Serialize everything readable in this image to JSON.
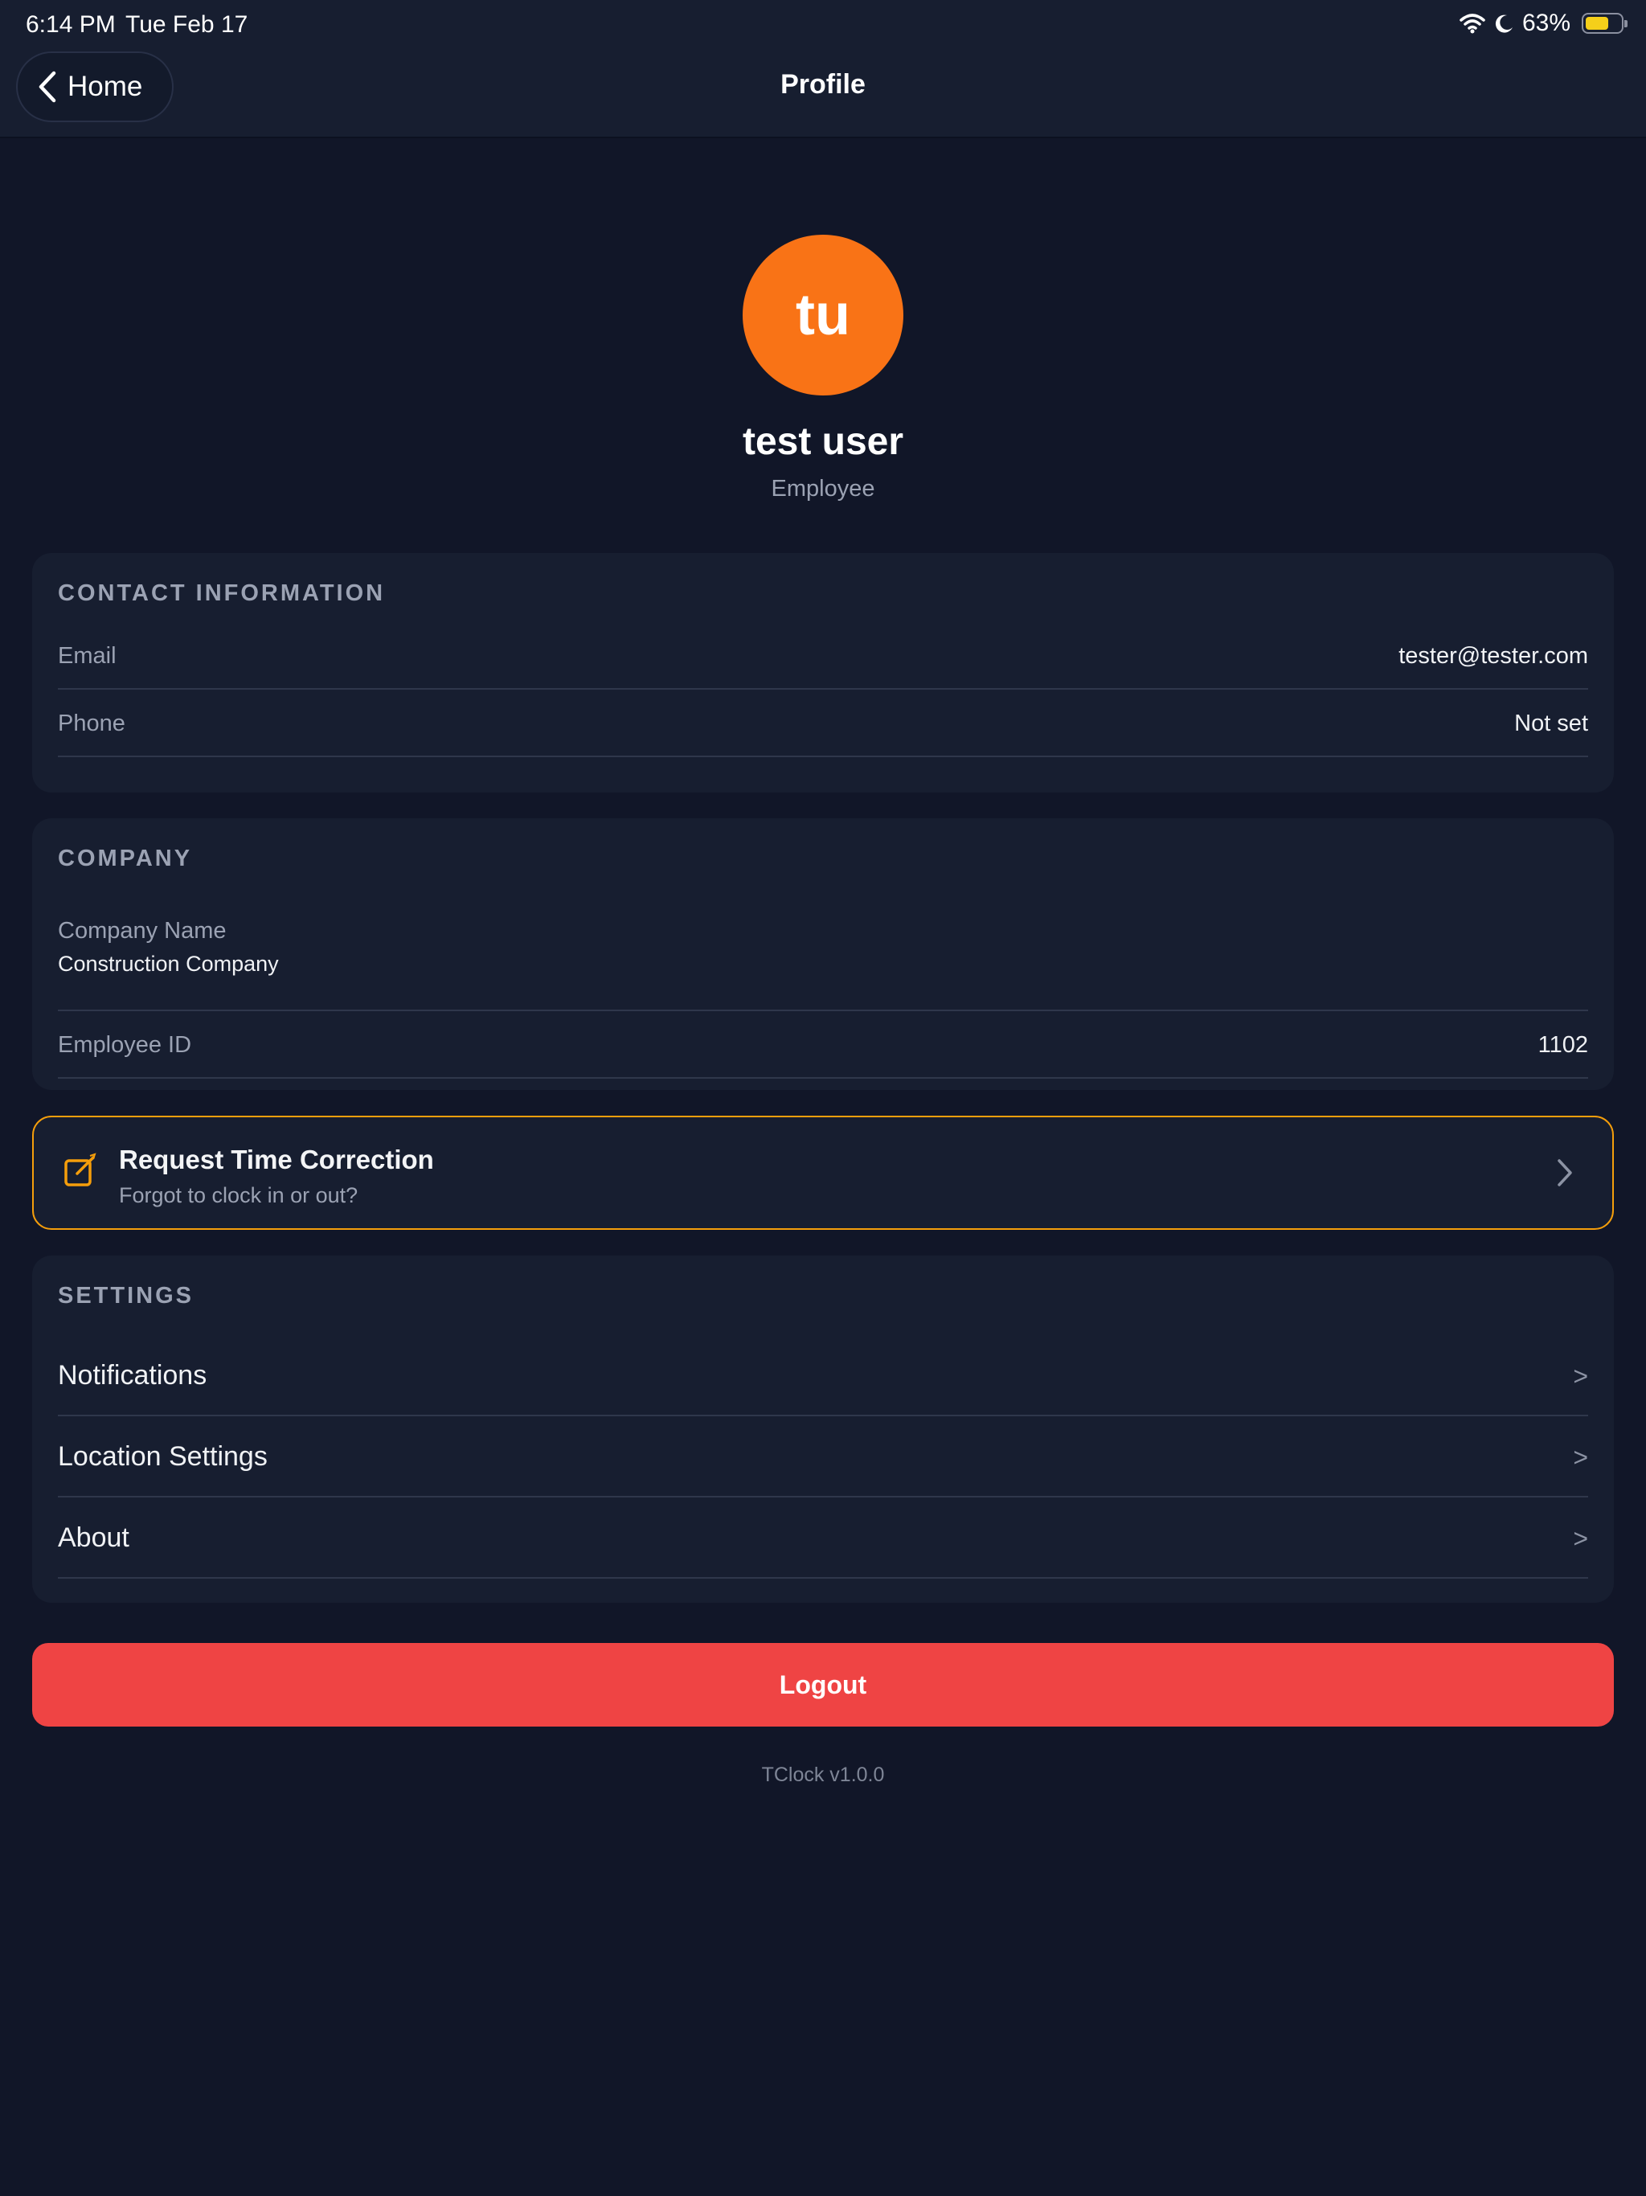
{
  "status_bar": {
    "time": "6:14 PM",
    "date": "Tue Feb 17",
    "battery": "63%",
    "battery_level": 0.63,
    "icons": [
      "wifi-icon",
      "moon-icon",
      "battery-icon"
    ]
  },
  "nav": {
    "back_label": "Home",
    "title": "Profile"
  },
  "profile": {
    "initials": "tu",
    "name": "test user",
    "role": "Employee",
    "avatar_color": "#f97316"
  },
  "contact": {
    "title": "CONTACT INFORMATION",
    "email_label": "Email",
    "email_value": "tester@tester.com",
    "phone_label": "Phone",
    "phone_value": "Not set"
  },
  "company": {
    "title": "COMPANY",
    "name_label": "Company Name",
    "name_value": "Construction Company",
    "employee_id_label": "Employee ID",
    "employee_id_value": "1102"
  },
  "correction": {
    "title": "Request Time Correction",
    "subtitle": "Forgot to clock in or out?",
    "accent": "#f59e0b"
  },
  "settings": {
    "title": "SETTINGS",
    "items": [
      {
        "label": "Notifications",
        "arrow": ">"
      },
      {
        "label": "Location Settings",
        "arrow": ">"
      },
      {
        "label": "About",
        "arrow": ">"
      }
    ]
  },
  "logout_label": "Logout",
  "logout_color": "#ef4444",
  "version": "TClock v1.0.0"
}
